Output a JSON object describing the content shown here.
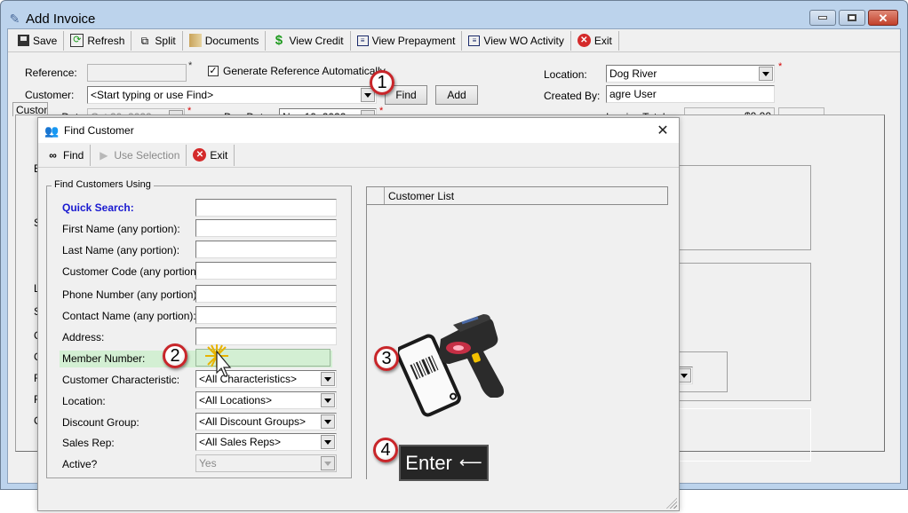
{
  "window": {
    "title": "Add Invoice",
    "controls": [
      "minimize",
      "maximize",
      "close"
    ]
  },
  "toolbar": {
    "items": [
      {
        "label": "Save",
        "icon": "floppy-disk-icon"
      },
      {
        "label": "Refresh",
        "icon": "refresh-icon"
      },
      {
        "label": "Split",
        "icon": "split-icon"
      },
      {
        "label": "Documents",
        "icon": "documents-icon"
      },
      {
        "label": "View Credit",
        "icon": "dollar-icon"
      },
      {
        "label": "View Prepayment",
        "icon": "report-icon"
      },
      {
        "label": "View WO Activity",
        "icon": "report-icon"
      },
      {
        "label": "Exit",
        "icon": "exit-icon"
      }
    ]
  },
  "form": {
    "reference_label": "Reference:",
    "reference_value": "",
    "generate_ref_label": "Generate Reference Automatically",
    "generate_ref_checked": true,
    "customer_label": "Customer:",
    "customer_placeholder": "<Start typing or use Find>",
    "find_label": "Find",
    "add_label": "Add",
    "invoice_date_label": "Invoice Date:",
    "invoice_date_value": "Oct 20, 2022",
    "due_date_label": "Due Date:",
    "due_date_value": "Nov 19, 2022",
    "location_label": "Location:",
    "location_value": "Dog River",
    "created_by_label": "Created By:",
    "created_by_value": "agre User",
    "invoice_total_label": "Invoice Total:",
    "invoice_total_value": "$0.00",
    "required_mark": "*",
    "tab_label": "Customer",
    "side_letters": [
      "B",
      "S",
      "L",
      "S",
      "C",
      "C",
      "F",
      "F",
      "C"
    ]
  },
  "dialog": {
    "title": "Find Customer",
    "close_glyph": "✕",
    "toolbar": [
      {
        "label": "Find",
        "icon": "binoculars-icon",
        "enabled": true
      },
      {
        "label": "Use Selection",
        "icon": "play-icon",
        "enabled": false
      },
      {
        "label": "Exit",
        "icon": "exit-icon",
        "enabled": true
      }
    ],
    "group_title": "Find Customers Using",
    "fields": [
      {
        "label": "Quick Search:",
        "value": ""
      },
      {
        "label": "First Name (any portion):",
        "value": ""
      },
      {
        "label": "Last Name (any portion):",
        "value": ""
      },
      {
        "label": "Customer Code (any portion):",
        "value": ""
      },
      {
        "label": "Phone Number (any portion):",
        "value": ""
      },
      {
        "label": "Contact Name (any portion):",
        "value": ""
      },
      {
        "label": "Address:",
        "value": ""
      },
      {
        "label": "Member Number:",
        "value": ""
      }
    ],
    "selects": [
      {
        "label": "Customer Characteristic:",
        "value": "<All Characteristics>"
      },
      {
        "label": "Location:",
        "value": "<All Locations>"
      },
      {
        "label": "Discount Group:",
        "value": "<All Discount Groups>"
      },
      {
        "label": "Sales Rep:",
        "value": "<All Sales Reps>"
      },
      {
        "label": "Active?",
        "value": "Yes",
        "disabled": true
      }
    ],
    "list_header": "Customer List"
  },
  "callouts": [
    "1",
    "2",
    "3",
    "4"
  ],
  "enter_key": {
    "label": "Enter",
    "glyph": "⟵"
  }
}
